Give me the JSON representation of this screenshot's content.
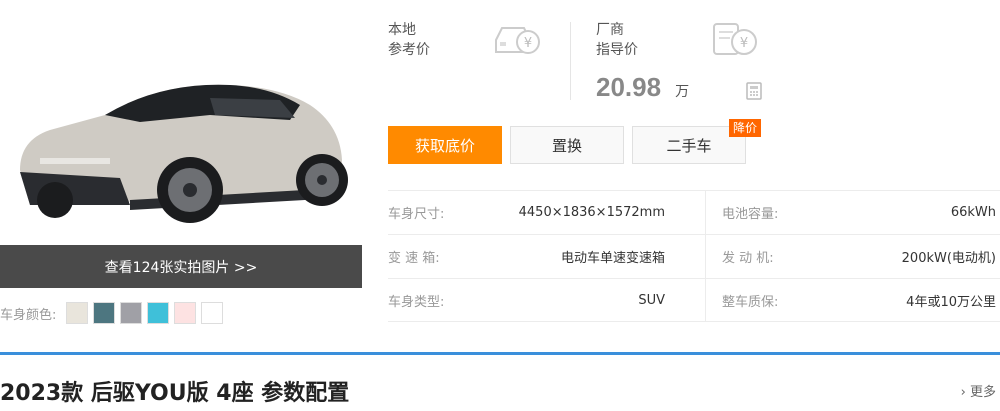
{
  "car": {
    "photo_link": "查看124张实拍图片 >>",
    "colors_label": "车身颜色:",
    "colors": [
      "#e9e5dc",
      "#4d7680",
      "#a0a0a6",
      "#3fc0d9",
      "#fde2e2",
      "#ffffff"
    ]
  },
  "price": {
    "local_label_1": "本地",
    "local_label_2": "参考价",
    "maker_label_1": "厂商",
    "maker_label_2": "指导价",
    "value": "20.98",
    "unit": "万"
  },
  "actions": {
    "get_price": "获取底价",
    "trade_in": "置换",
    "used_car": "二手车",
    "used_badge": "降价"
  },
  "specs": [
    {
      "k1": "车身尺寸:",
      "v1": "4450×1836×1572mm",
      "k2": "电池容量:",
      "v2": "66kWh"
    },
    {
      "k1": "变 速 箱:",
      "v1": "电动车单速变速箱",
      "k2": "发 动 机:",
      "v2": "200kW(电动机)"
    },
    {
      "k1": "车身类型:",
      "v1": "SUV",
      "k2": "整车质保:",
      "v2": "4年或10万公里"
    }
  ],
  "section": {
    "title": "2023款 后驱YOU版 4座 参数配置",
    "more": "› 更多"
  },
  "colors": {
    "accent": "#ff8a00",
    "badge": "#ff6600",
    "section_line": "#3a8fdb",
    "photo_bar": "#4a4a4a"
  }
}
